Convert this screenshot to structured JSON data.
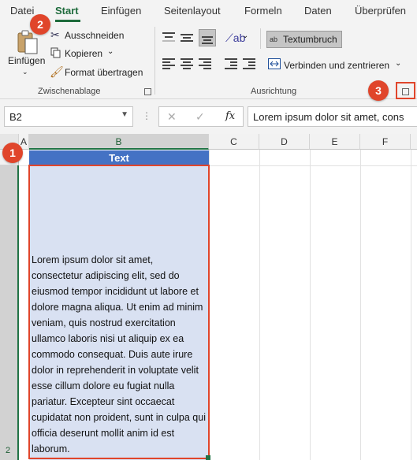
{
  "tabs": [
    "Datei",
    "Start",
    "Einfügen",
    "Seitenlayout",
    "Formeln",
    "Daten",
    "Überprüfen"
  ],
  "ribbon": {
    "paste_label": "Einfügen",
    "cut_label": "Ausschneiden",
    "copy_label": "Kopieren",
    "format_painter_label": "Format übertragen",
    "clipboard_group": "Zwischenablage",
    "wrap_text_label": "Textumbruch",
    "wrap_icon_text": "ab",
    "merge_center_label": "Verbinden und zentrieren",
    "alignment_group": "Ausrichtung"
  },
  "formula_bar": {
    "name_box": "B2",
    "fx_label": "fx",
    "formula_text": "Lorem ipsum dolor sit amet, cons"
  },
  "grid": {
    "columns": [
      "A",
      "B",
      "C",
      "D",
      "E",
      "F"
    ],
    "row_numbers": [
      "2"
    ],
    "header_cell": "Text",
    "cell_text": "Lorem ipsum dolor sit amet, consectetur adipiscing elit, sed do eiusmod tempor incididunt ut labore et dolore magna aliqua. Ut enim ad minim veniam, quis nostrud exercitation ullamco laboris nisi ut aliquip ex ea commodo consequat. Duis aute irure dolor in reprehenderit in voluptate velit esse cillum dolore eu fugiat nulla pariatur. Excepteur sint occaecat cupidatat non proident, sunt in culpa qui officia deserunt mollit anim id est laborum."
  },
  "badges": [
    "1",
    "2",
    "3"
  ],
  "colors": {
    "accent": "#217346",
    "header_fill": "#4472c4",
    "cell_fill": "#d9e1f2",
    "badge": "#e0452b"
  }
}
